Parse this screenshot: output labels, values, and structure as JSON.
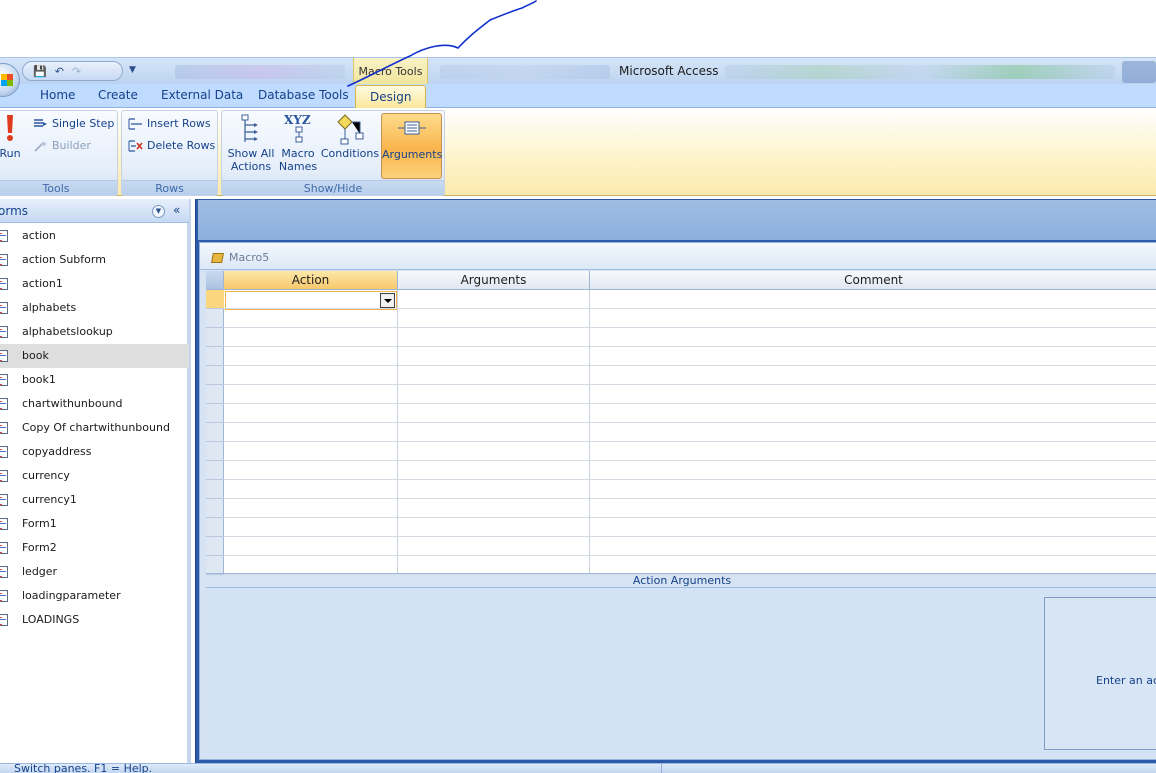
{
  "window": {
    "title": "Microsoft Access",
    "context_tab_group": "Macro Tools"
  },
  "tabs": [
    {
      "label": "Home"
    },
    {
      "label": "Create"
    },
    {
      "label": "External Data"
    },
    {
      "label": "Database Tools"
    },
    {
      "label": "Design",
      "active": true
    }
  ],
  "ribbon": {
    "groups": {
      "tools": {
        "label": "Tools",
        "run": "Run",
        "single_step": "Single Step",
        "builder": "Builder"
      },
      "rows": {
        "label": "Rows",
        "insert_rows": "Insert Rows",
        "delete_rows": "Delete Rows"
      },
      "showhide": {
        "label": "Show/Hide",
        "show_all_actions_1": "Show All",
        "show_all_actions_2": "Actions",
        "macro_names_1": "Macro",
        "macro_names_2": "Names",
        "conditions": "Conditions",
        "arguments": "Arguments",
        "macro_names_icon_text": "XYZ"
      }
    }
  },
  "nav": {
    "header": "orms",
    "collapse_glyph": "«",
    "items": [
      {
        "label": "action"
      },
      {
        "label": "action Subform"
      },
      {
        "label": "action1"
      },
      {
        "label": "alphabets"
      },
      {
        "label": "alphabetslookup"
      },
      {
        "label": "book",
        "selected": true
      },
      {
        "label": "book1"
      },
      {
        "label": "chartwithunbound"
      },
      {
        "label": "Copy Of chartwithunbound"
      },
      {
        "label": "copyaddress"
      },
      {
        "label": "currency"
      },
      {
        "label": "currency1"
      },
      {
        "label": "Form1"
      },
      {
        "label": "Form2"
      },
      {
        "label": "ledger"
      },
      {
        "label": "loadingparameter"
      },
      {
        "label": "LOADINGS"
      }
    ]
  },
  "macro": {
    "tab_title": "Macro5",
    "columns": {
      "action": "Action",
      "arguments": "Arguments",
      "comment": "Comment"
    },
    "action_arguments_label": "Action Arguments",
    "help_text": "Enter an act"
  },
  "status": {
    "text": "Switch panes.  F1 = Help."
  },
  "colors": {
    "ribbon_tab_bar": "#bfdbff",
    "active_highlight": "#f9b44c",
    "workspace": "#2d5aa8",
    "annotation_stroke": "#1030d0"
  }
}
